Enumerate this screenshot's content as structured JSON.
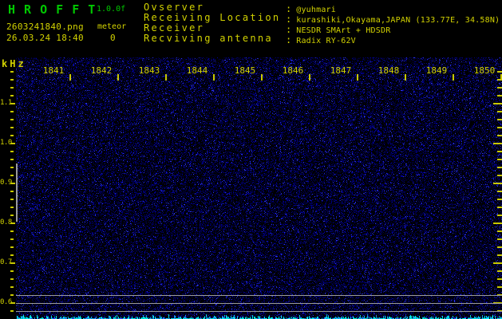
{
  "colors": {
    "background": "#000000",
    "title_green": "#00c800",
    "text_yellow": "#d2d200",
    "tick_yellow": "#c8c800",
    "line_gray": "#9a9a9a",
    "trace_cyan": "#00d8d8",
    "noise_blue": "#2020c8"
  },
  "header": {
    "app_title": "H R O F F T",
    "version": "1.0.0f",
    "filename": "2603241840.png",
    "meteor_label": "meteor",
    "meteor_count": "0",
    "timestamp": "26.03.24 18:40",
    "colon": ":",
    "info": [
      {
        "label": "Ovserver",
        "value": "@yuhmari"
      },
      {
        "label": "Receiving Location",
        "value": "kurashiki,Okayama,JAPAN (133.77E, 34.58N)"
      },
      {
        "label": "Receiver",
        "value": "NESDR SMArt + HDSDR"
      },
      {
        "label": "Recviving antenna",
        "value": "Radix RY-62V"
      }
    ]
  },
  "chart_data": {
    "type": "heatmap",
    "subtype": "radio-meteor-spectrogram",
    "ylabel": "kHz",
    "x_ticks": [
      "1841",
      "1842",
      "1843",
      "1844",
      "1845",
      "1846",
      "1847",
      "1848",
      "1849",
      "1850"
    ],
    "y_ticks": [
      "1.1",
      "1.0",
      "0.9",
      "0.8",
      "0.7",
      "0.6"
    ],
    "ylim_khz": [
      0.56,
      1.22
    ],
    "x_span_minutes": 10,
    "horizontal_lines_khz": [
      0.62,
      0.6,
      0.58
    ],
    "elevated_noise_bar_khz": [
      0.804,
      0.95
    ],
    "meteor_count": 0,
    "grid": false,
    "content_note": "uniform dark-blue receiver noise speckle, no meteor echoes; cyan noise-floor trace along bottom edge"
  }
}
